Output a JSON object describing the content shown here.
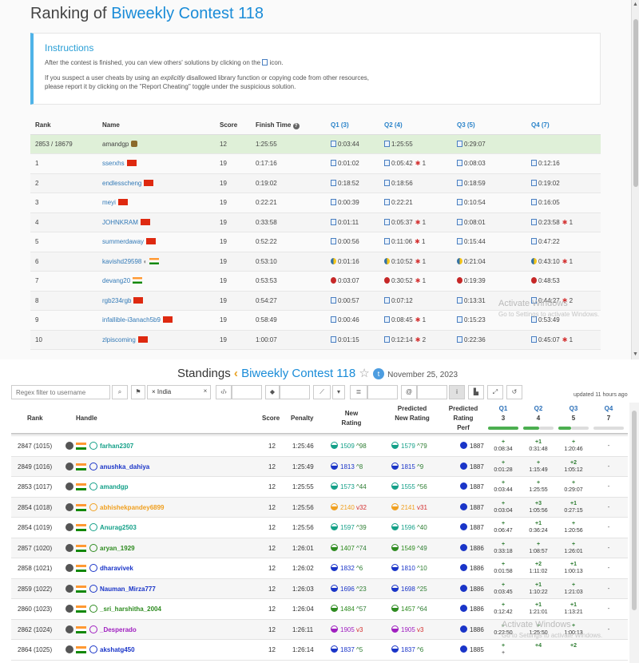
{
  "leetcode": {
    "title_prefix": "Ranking of",
    "contest_name": "Biweekly Contest 118",
    "instructions": {
      "heading": "Instructions",
      "line1_a": "After the contest is finished, you can view others' solutions by clicking on the",
      "line1_b": "icon.",
      "line2_a": "If you suspect a user cheats by using an",
      "line2_em": "explicitly",
      "line2_b": "disallowed library function or copying code from other resources,",
      "line3": "please report it by clicking on the \"Report Cheating\" toggle under the suspicious solution."
    },
    "headers": [
      "Rank",
      "Name",
      "Score",
      "Finish Time",
      "Q1 (3)",
      "Q2 (4)",
      "Q3 (5)",
      "Q4 (7)"
    ],
    "rows": [
      {
        "rank": "2853 / 18679",
        "name": "amandgp",
        "flag": "",
        "score": "12",
        "finish": "1:25:55",
        "q1": "0:03:44",
        "q2": "1:25:55",
        "q3": "0:29:07",
        "q4": "",
        "q2b": "",
        "q4b": "",
        "lang": "doc",
        "me": true
      },
      {
        "rank": "1",
        "name": "sserxhs",
        "flag": "cn",
        "score": "19",
        "finish": "0:17:16",
        "q1": "0:01:02",
        "q2": "0:05:42",
        "q3": "0:08:03",
        "q4": "0:12:16",
        "q2b": "1",
        "q4b": "",
        "lang": "doc"
      },
      {
        "rank": "2",
        "name": "endlesscheng",
        "flag": "cn",
        "score": "19",
        "finish": "0:19:02",
        "q1": "0:18:52",
        "q2": "0:18:56",
        "q3": "0:18:59",
        "q4": "0:19:02",
        "q2b": "",
        "q4b": "",
        "lang": "doc"
      },
      {
        "rank": "3",
        "name": "meyi",
        "flag": "cn",
        "score": "19",
        "finish": "0:22:21",
        "q1": "0:00:39",
        "q2": "0:22:21",
        "q3": "0:10:54",
        "q4": "0:16:05",
        "q2b": "",
        "q4b": "",
        "lang": "doc"
      },
      {
        "rank": "4",
        "name": "JOHNKRAM",
        "flag": "cn",
        "score": "19",
        "finish": "0:33:58",
        "q1": "0:01:11",
        "q2": "0:05:37",
        "q3": "0:08:01",
        "q4": "0:23:58",
        "q2b": "1",
        "q4b": "1",
        "lang": "doc"
      },
      {
        "rank": "5",
        "name": "summerdaway",
        "flag": "cn",
        "score": "19",
        "finish": "0:52:22",
        "q1": "0:00:56",
        "q2": "0:11:06",
        "q3": "0:15:44",
        "q4": "0:47:22",
        "q2b": "1",
        "q4b": "",
        "lang": "doc"
      },
      {
        "rank": "6",
        "name": "kavishd29598",
        "flag": "in",
        "score": "19",
        "finish": "0:53:10",
        "q1": "0:01:16",
        "q2": "0:10:52",
        "q3": "0:21:04",
        "q4": "0:43:10",
        "q2b": "1",
        "q4b": "1",
        "lang": "py"
      },
      {
        "rank": "7",
        "name": "devang20",
        "flag": "in",
        "score": "19",
        "finish": "0:53:53",
        "q1": "0:03:07",
        "q2": "0:30:52",
        "q3": "0:19:39",
        "q4": "0:48:53",
        "q2b": "1",
        "q4b": "",
        "lang": "cpp"
      },
      {
        "rank": "8",
        "name": "rgb234rgb",
        "flag": "cn",
        "score": "19",
        "finish": "0:54:27",
        "q1": "0:00:57",
        "q2": "0:07:12",
        "q3": "0:13:31",
        "q4": "0:44:27",
        "q2b": "",
        "q4b": "2",
        "lang": "doc"
      },
      {
        "rank": "9",
        "name": "infallible-i3anach5b9",
        "flag": "cn",
        "score": "19",
        "finish": "0:58:49",
        "q1": "0:00:46",
        "q2": "0:08:45",
        "q3": "0:15:23",
        "q4": "0:53:49",
        "q2b": "1",
        "q4b": "",
        "lang": "doc"
      },
      {
        "rank": "10",
        "name": "zlpiscoming",
        "flag": "cn",
        "score": "19",
        "finish": "1:00:07",
        "q1": "0:01:15",
        "q2": "0:12:14",
        "q3": "0:22:36",
        "q4": "0:45:07",
        "q2b": "2",
        "q4b": "1",
        "lang": "doc"
      }
    ],
    "watermark_title": "Activate Windows",
    "watermark_sub": "Go to Settings to activate Windows."
  },
  "standings": {
    "title": "Standings",
    "contest_name": "Biweekly Contest 118",
    "date": "November 25, 2023",
    "toolbar": {
      "filter_placeholder": "Regex filter to username",
      "country_chip": "× India",
      "updated": "updated 11 hours ago"
    },
    "headers": {
      "rank": "Rank",
      "handle": "Handle",
      "score": "Score",
      "penalty": "Penalty",
      "new_rating": "New Rating",
      "pred_new": "Predicted New Rating",
      "pred_perf": "Predicted Rating Perf",
      "q1": "Q1",
      "q1n": "3",
      "q2": "Q2",
      "q2n": "4",
      "q3": "Q3",
      "q3n": "5",
      "q4": "Q4",
      "q4n": "7"
    },
    "rows": [
      {
        "rank": "2847 (1015)",
        "handle": "farhan2307",
        "color": "#14a088",
        "score": "12",
        "penalty": "1:25:46",
        "nr": "1509",
        "nrd": "^98",
        "nrup": true,
        "pr": "1579",
        "prd": "^79",
        "prup": true,
        "perf": "1887",
        "q1": "0:08:34",
        "q2a": "+1",
        "q2": "0:31:48",
        "q3a": "+",
        "q3": "1:20:46",
        "q4": "-"
      },
      {
        "rank": "2849 (1016)",
        "handle": "anushka_dahiya",
        "color": "#1a35c8",
        "score": "12",
        "penalty": "1:25:49",
        "nr": "1813",
        "nrd": "^8",
        "nrup": true,
        "pr": "1815",
        "prd": "^9",
        "prup": true,
        "perf": "1887",
        "q1": "0:01:28",
        "q2a": "+",
        "q2": "1:15:49",
        "q3a": "+2",
        "q3": "1:05:12",
        "q4": "-"
      },
      {
        "rank": "2853 (1017)",
        "handle": "amandgp",
        "color": "#14a088",
        "score": "12",
        "penalty": "1:25:55",
        "nr": "1573",
        "nrd": "^44",
        "nrup": true,
        "pr": "1555",
        "prd": "^56",
        "prup": true,
        "perf": "1887",
        "q1": "0:03:44",
        "q2a": "+",
        "q2": "1:25:55",
        "q3a": "+",
        "q3": "0:29:07",
        "q4": "-"
      },
      {
        "rank": "2854 (1018)",
        "handle": "abhishekpandey6899",
        "color": "#f0a020",
        "score": "12",
        "penalty": "1:25:56",
        "nr": "2140",
        "nrd": "v32",
        "nrup": false,
        "pr": "2141",
        "prd": "v31",
        "prup": false,
        "perf": "1887",
        "q1": "0:03:04",
        "q2a": "+3",
        "q2": "1:05:56",
        "q3a": "+1",
        "q3": "0:27:15",
        "q4": "-"
      },
      {
        "rank": "2854 (1019)",
        "handle": "Anurag2503",
        "color": "#14a088",
        "score": "12",
        "penalty": "1:25:56",
        "nr": "1597",
        "nrd": "^39",
        "nrup": true,
        "pr": "1596",
        "prd": "^40",
        "prup": true,
        "perf": "1887",
        "q1": "0:06:47",
        "q2a": "+1",
        "q2": "0:36:24",
        "q3a": "+",
        "q3": "1:20:56",
        "q4": "-"
      },
      {
        "rank": "2857 (1020)",
        "handle": "aryan_1929",
        "color": "#2e8b20",
        "score": "12",
        "penalty": "1:26:01",
        "nr": "1407",
        "nrd": "^74",
        "nrup": true,
        "pr": "1549",
        "prd": "^49",
        "prup": true,
        "perf": "1886",
        "q1": "0:33:18",
        "q2a": "+",
        "q2": "1:08:57",
        "q3a": "+",
        "q3": "1:26:01",
        "q4": "-"
      },
      {
        "rank": "2858 (1021)",
        "handle": "dharavivek",
        "color": "#1a35c8",
        "score": "12",
        "penalty": "1:26:02",
        "nr": "1832",
        "nrd": "^6",
        "nrup": true,
        "pr": "1810",
        "prd": "^10",
        "prup": true,
        "perf": "1886",
        "q1": "0:01:58",
        "q2a": "+2",
        "q2": "1:11:02",
        "q3a": "+1",
        "q3": "1:00:13",
        "q4": "-"
      },
      {
        "rank": "2859 (1022)",
        "handle": "Nauman_Mirza777",
        "color": "#1a35c8",
        "score": "12",
        "penalty": "1:26:03",
        "nr": "1696",
        "nrd": "^23",
        "nrup": true,
        "pr": "1698",
        "prd": "^25",
        "prup": true,
        "perf": "1886",
        "q1": "0:03:45",
        "q2a": "+1",
        "q2": "1:10:22",
        "q3a": "+",
        "q3": "1:21:03",
        "q4": "-"
      },
      {
        "rank": "2860 (1023)",
        "handle": "_sri_harshitha_2004",
        "color": "#2e8b20",
        "score": "12",
        "penalty": "1:26:04",
        "nr": "1484",
        "nrd": "^57",
        "nrup": true,
        "pr": "1457",
        "prd": "^64",
        "prup": true,
        "perf": "1886",
        "q1": "0:12:42",
        "q2a": "+1",
        "q2": "1:21:01",
        "q3a": "+1",
        "q3": "1:13:21",
        "q4": "-"
      },
      {
        "rank": "2862 (1024)",
        "handle": "_Desperado",
        "color": "#a020c0",
        "score": "12",
        "penalty": "1:26:11",
        "nr": "1905",
        "nrd": "v3",
        "nrup": false,
        "pr": "1905",
        "prd": "v3",
        "prup": false,
        "perf": "1886",
        "q1": "0:22:50",
        "q2a": "+",
        "q2": "1:25:50",
        "q3a": "+",
        "q3": "1:00:13",
        "q4": "-"
      },
      {
        "rank": "2864 (1025)",
        "handle": "akshatg450",
        "color": "#1a35c8",
        "score": "12",
        "penalty": "1:26:14",
        "nr": "1837",
        "nrd": "^5",
        "nrup": true,
        "pr": "1837",
        "prd": "^6",
        "prup": true,
        "perf": "1885",
        "q1": "+",
        "q2a": "+4",
        "q2": "",
        "q3a": "+2",
        "q3": "",
        "q4": ""
      }
    ],
    "watermark_title": "Activate Windows",
    "watermark_sub": "Go to Settings to activate Windows."
  }
}
